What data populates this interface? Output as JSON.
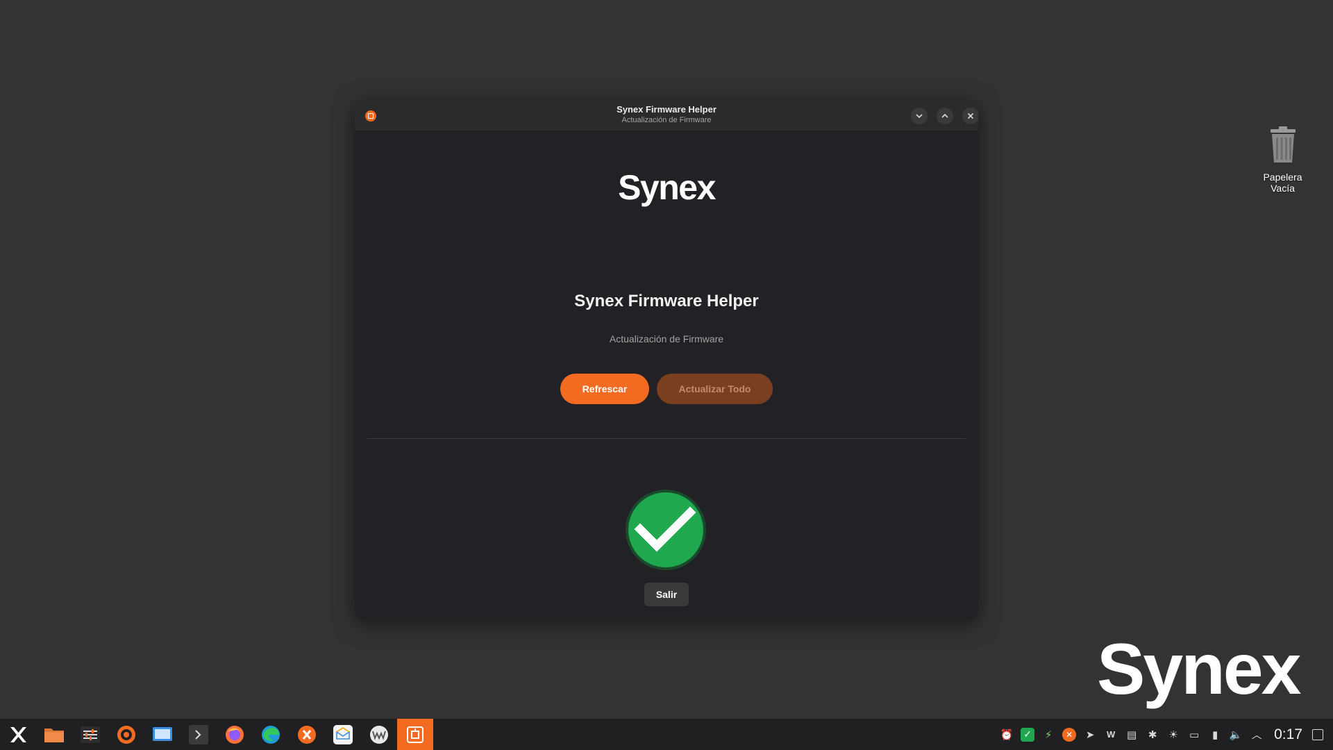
{
  "desktop": {
    "wallpaper_logo": "Synex",
    "trash": {
      "label_line1": "Papelera",
      "label_line2": "Vacía",
      "icon": "trash-icon"
    }
  },
  "window": {
    "title": "Synex Firmware Helper",
    "subtitle": "Actualización de Firmware",
    "controls": {
      "minimize_icon": "chevron-down-icon",
      "maximize_icon": "chevron-up-icon",
      "close_icon": "close-icon"
    },
    "accent_color": "#f26b21"
  },
  "main": {
    "logo": "Synex",
    "heading": "Synex Firmware Helper",
    "subheading": "Actualización de Firmware",
    "refresh_label": "Refrescar",
    "update_all_label": "Actualizar Todo",
    "status_icon": "check-circle-icon",
    "status_color": "#1fa84e",
    "exit_label": "Salir"
  },
  "taskbar": {
    "apps": [
      {
        "name": "start-menu",
        "icon": "synex-logo-icon"
      },
      {
        "name": "files",
        "icon": "folder-icon"
      },
      {
        "name": "settings",
        "icon": "sliders-icon"
      },
      {
        "name": "software",
        "icon": "software-center-icon"
      },
      {
        "name": "remote-desktop",
        "icon": "monitor-icon"
      },
      {
        "name": "terminal",
        "icon": "terminal-icon"
      },
      {
        "name": "firefox",
        "icon": "firefox-icon"
      },
      {
        "name": "edge",
        "icon": "edge-icon"
      },
      {
        "name": "synex-chat",
        "icon": "synex-chat-icon"
      },
      {
        "name": "mail",
        "icon": "mail-icon"
      },
      {
        "name": "wm",
        "icon": "wm-icon"
      },
      {
        "name": "firmware-helper",
        "icon": "firmware-helper-icon"
      }
    ],
    "tray": {
      "icons": [
        "alarm-icon",
        "check-icon",
        "network-activity-icon",
        "synex-update-icon",
        "send-icon",
        "wm-tray-icon",
        "clipboard-icon",
        "bluetooth-icon",
        "brightness-icon",
        "display-icon",
        "battery-icon",
        "volume-icon",
        "chevron-up-icon"
      ],
      "clock": "0:17"
    }
  }
}
